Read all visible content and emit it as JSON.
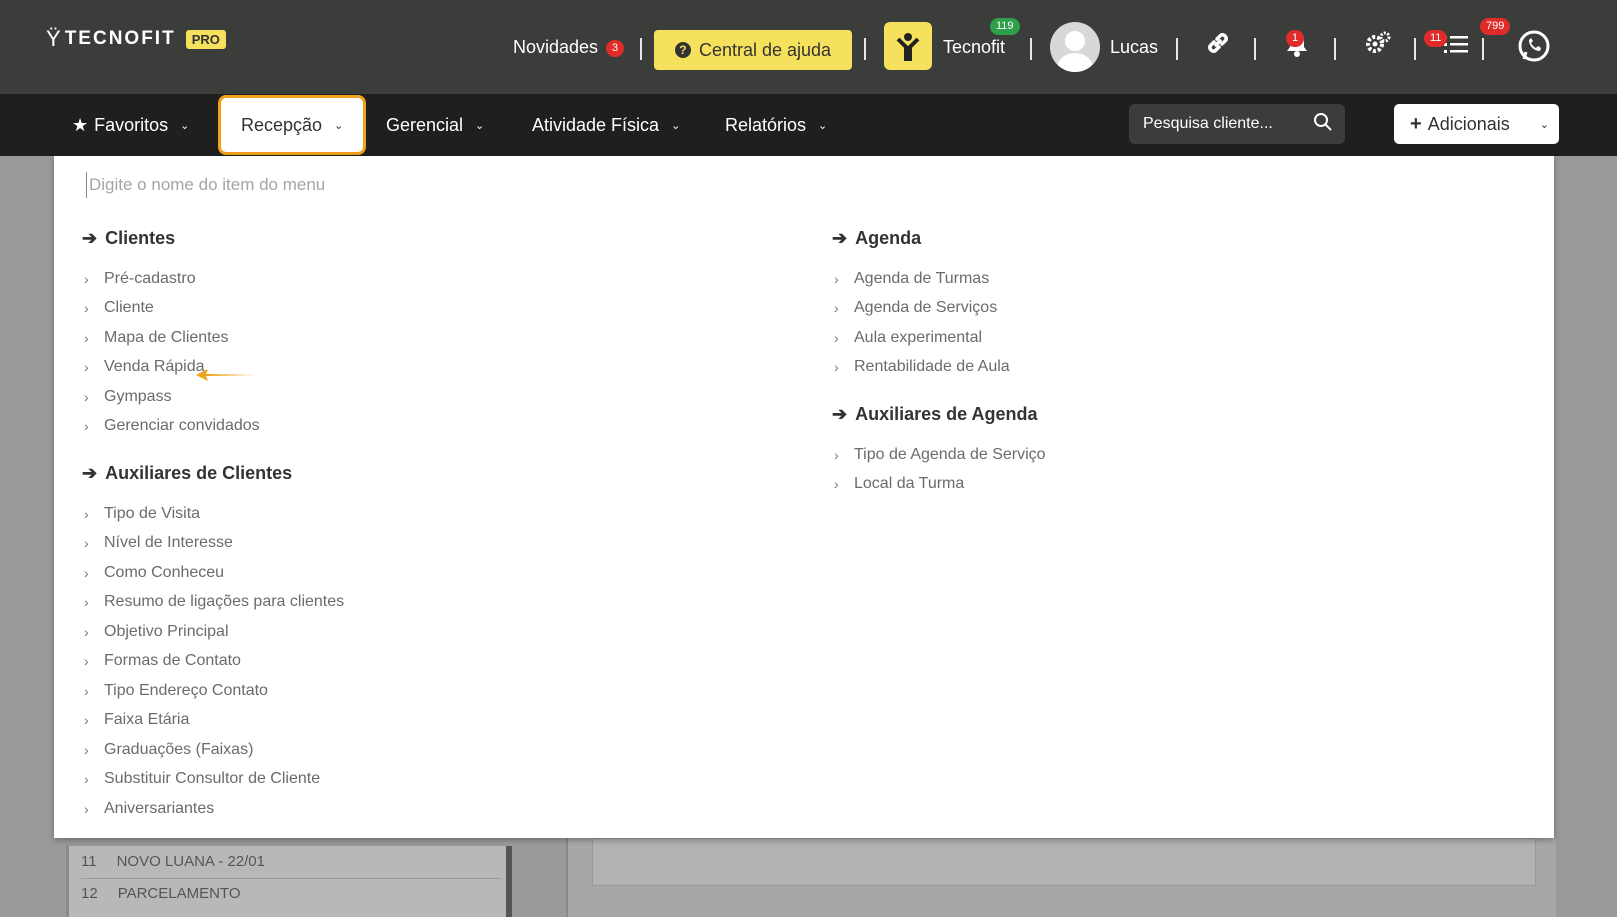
{
  "header": {
    "logo_text": "TECNOFIT",
    "logo_badge": "PRO",
    "novidades_label": "Novidades",
    "novidades_count": "3",
    "help_label": "Central de ajuda",
    "tecnofit_label": "Tecnofit",
    "tecnofit_count": "119",
    "user_name": "Lucas",
    "notifications_count": "1",
    "tasks_count": "11",
    "whatsapp_count": "799"
  },
  "nav": {
    "favoritos": "Favoritos",
    "recepcao": "Recepção",
    "gerencial": "Gerencial",
    "atividade": "Atividade Física",
    "relatorios": "Relatórios",
    "search_placeholder": "Pesquisa cliente...",
    "add_label": "Adicionais"
  },
  "dropdown": {
    "filter_placeholder": "Digite o nome do item do menu",
    "left": {
      "clientes_title": "Clientes",
      "clientes_items": [
        "Pré-cadastro",
        "Cliente",
        "Mapa de Clientes",
        "Venda Rápida",
        "Gympass",
        "Gerenciar convidados"
      ],
      "aux_title": "Auxiliares de Clientes",
      "aux_items": [
        "Tipo de Visita",
        "Nível de Interesse",
        "Como Conheceu",
        "Resumo de ligações para clientes",
        "Objetivo Principal",
        "Formas de Contato",
        "Tipo Endereço Contato",
        "Faixa Etária",
        "Graduações (Faixas)",
        "Substituir Consultor de Cliente",
        "Aniversariantes"
      ]
    },
    "right": {
      "agenda_title": "Agenda",
      "agenda_items": [
        "Agenda de Turmas",
        "Agenda de Serviços",
        "Aula experimental",
        "Rentabilidade de Aula"
      ],
      "aux_title": "Auxiliares de Agenda",
      "aux_items": [
        "Tipo de Agenda de Serviço",
        "Local da Turma"
      ]
    }
  },
  "background": {
    "rows": [
      {
        "num": "11",
        "name": "NOVO LUANA - 22/01"
      },
      {
        "num": "12",
        "name": "PARCELAMENTO"
      }
    ]
  },
  "colors": {
    "accent_yellow": "#f5e15c",
    "active_border": "#f0a21a",
    "topbar": "#3a3d3a",
    "navbar": "#1e1f1e",
    "badge_red": "#e02b2b",
    "badge_green": "#2ea04a"
  }
}
